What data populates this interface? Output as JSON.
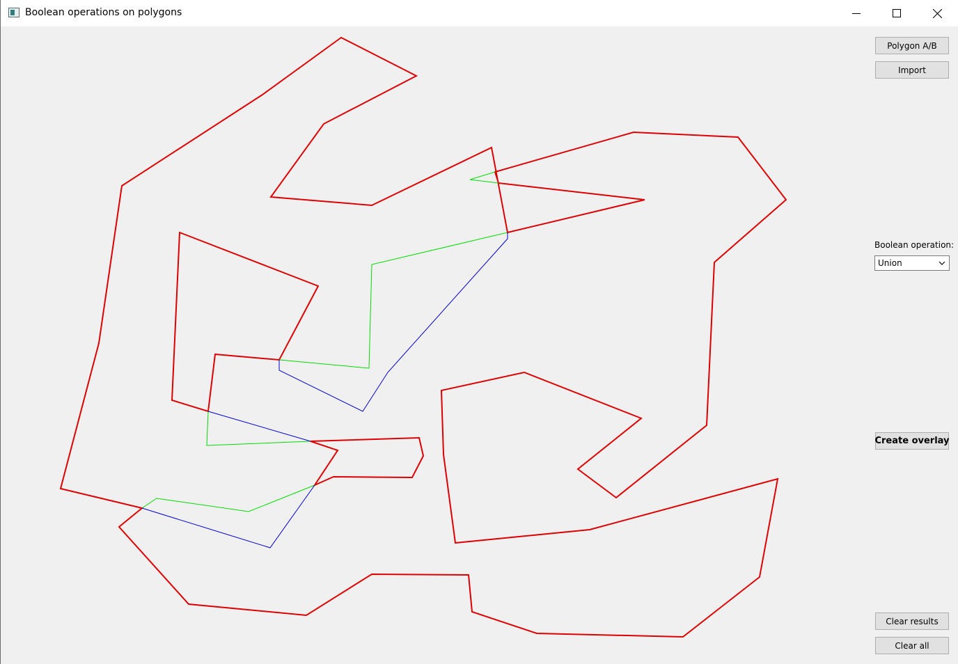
{
  "window": {
    "title": "Boolean operations on polygons",
    "controls": [
      "minimize-icon",
      "maximize-icon",
      "close-icon"
    ]
  },
  "sidebar": {
    "polygon_ab_label": "Polygon A/B",
    "import_label": "Import",
    "operation_label": "Boolean operation:",
    "operation_value": "Union",
    "create_overlay_label": "Create overlay",
    "clear_results_label": "Clear results",
    "clear_all_label": "Clear all"
  },
  "colors": {
    "polygon_a": "#dd0000",
    "polygon_b": "#00dd00",
    "result": "#0000cc"
  }
}
